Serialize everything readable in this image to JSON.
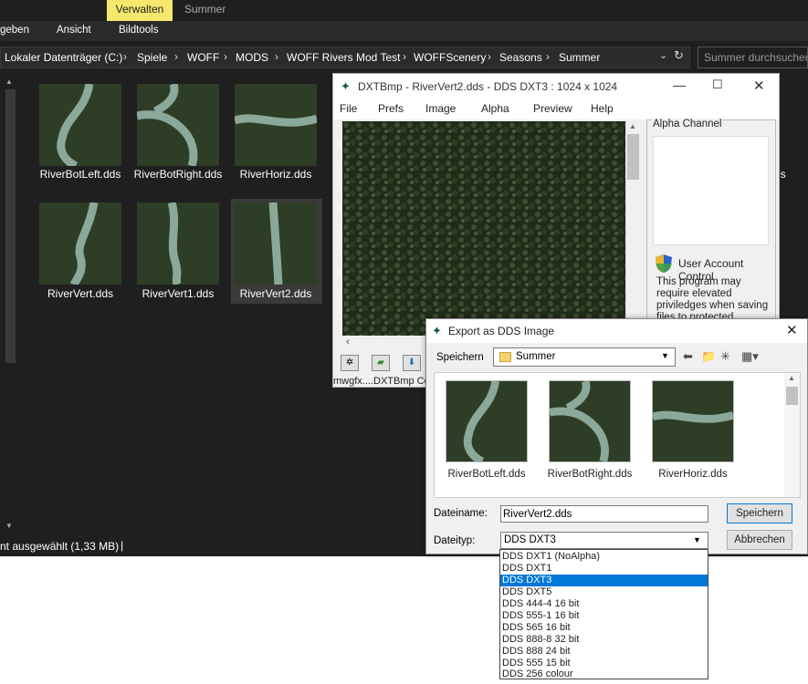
{
  "explorer": {
    "context_tabs": {
      "verwalten": "Verwalten",
      "summer": "Summer"
    },
    "ribbon_tabs": [
      "geben",
      "Ansicht",
      "Bildtools"
    ],
    "breadcrumb": [
      "Lokaler Datenträger (C:)",
      "Spiele",
      "WOFF",
      "MODS",
      "WOFF Rivers Mod Test",
      "WOFFScenery",
      "Seasons",
      "Summer"
    ],
    "search_placeholder": "Summer durchsuchen",
    "files": [
      {
        "name": "RiverBotLeft.dds",
        "icon": "river-bot-left-thumbnail"
      },
      {
        "name": "RiverBotRight.dds",
        "icon": "river-bot-right-thumbnail"
      },
      {
        "name": "RiverHoriz.dds",
        "icon": "river-horiz-thumbnail"
      },
      {
        "name": "RiverVert.dds",
        "icon": "river-vert-thumbnail"
      },
      {
        "name": "RiverVert1.dds",
        "icon": "river-vert1-thumbnail"
      },
      {
        "name": "RiverVert2.dds",
        "icon": "river-vert2-thumbnail",
        "selected": true
      }
    ],
    "partial_filename": "ds",
    "status": "nt ausgewählt (1,33 MB)"
  },
  "dxtbmp": {
    "title": "DXTBmp - RiverVert2.dds - DDS DXT3 : 1024 x 1024",
    "menu": [
      "File",
      "Prefs",
      "Image",
      "Alpha",
      "Preview",
      "Help"
    ],
    "alpha_channel_label": "Alpha Channel",
    "uac_title": "User Account Control",
    "uac_text": "This program may require elevated priviledges when saving files to protected locations. You may be",
    "status": "mwgfx....DXTBmp Co"
  },
  "dialog": {
    "title": "Export as DDS Image",
    "save_in_label": "Speichern",
    "folder": "Summer",
    "files": [
      "RiverBotLeft.dds",
      "RiverBotRight.dds",
      "RiverHoriz.dds"
    ],
    "filename_label": "Dateiname:",
    "filename_value": "RiverVert2.dds",
    "filetype_label": "Dateityp:",
    "filetype_value": "DDS DXT3",
    "save_button": "Speichern",
    "cancel_button": "Abbrechen",
    "filetype_options": [
      "DDS DXT1 (NoAlpha)",
      "DDS DXT1",
      "DDS DXT3",
      "DDS DXT5",
      "DDS 444-4 16 bit",
      "DDS 555-1 16 bit",
      "DDS 565 16 bit",
      "DDS 888-8 32 bit",
      "DDS 888 24 bit",
      "DDS 555 15 bit",
      "DDS 256 colour"
    ],
    "selected_option": "DDS DXT3"
  },
  "colors": {
    "accent": "#0078d7",
    "context_tab": "#f5e86c",
    "dark_bg": "#1f1f1f"
  }
}
